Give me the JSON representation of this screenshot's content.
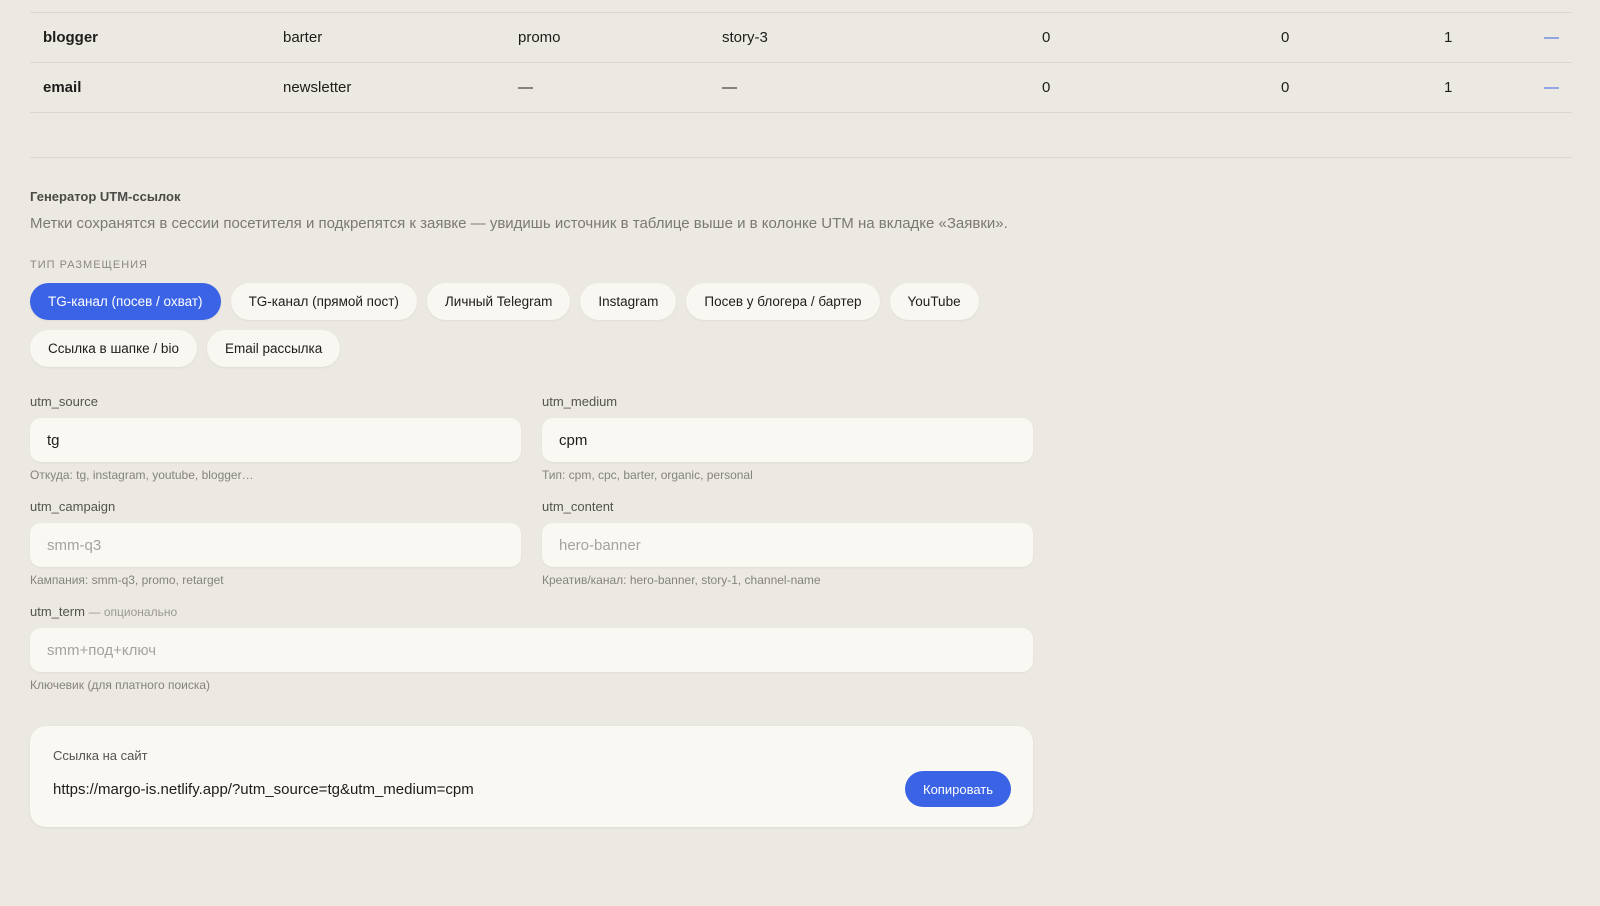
{
  "table": {
    "rows": [
      {
        "source": "blogger",
        "medium": "barter",
        "campaign": "promo",
        "content": "story-3",
        "n1": "0",
        "n2": "0",
        "n3": "1",
        "link": "—"
      },
      {
        "source": "email",
        "medium": "newsletter",
        "campaign": "—",
        "content": "—",
        "n1": "0",
        "n2": "0",
        "n3": "1",
        "link": "—"
      }
    ]
  },
  "generator": {
    "title": "Генератор UTM-ссылок",
    "description": "Метки сохранятся в сессии посетителя и подкрепятся к заявке — увидишь источник в таблице выше и в колонке UTM на вкладке «Заявки».",
    "type_label": "ТИП РАЗМЕЩЕНИЯ",
    "chips": [
      {
        "label": "TG-канал (посев / охват)",
        "active": true
      },
      {
        "label": "TG-канал (прямой пост)",
        "active": false
      },
      {
        "label": "Личный Telegram",
        "active": false
      },
      {
        "label": "Instagram",
        "active": false
      },
      {
        "label": "Посев у блогера / бартер",
        "active": false
      },
      {
        "label": "YouTube",
        "active": false
      },
      {
        "label": "Ссылка в шапке / bio",
        "active": false
      },
      {
        "label": "Email рассылка",
        "active": false
      }
    ],
    "fields": {
      "utm_source": {
        "label": "utm_source",
        "value": "tg",
        "hint": "Откуда: tg, instagram, youtube, blogger…"
      },
      "utm_medium": {
        "label": "utm_medium",
        "value": "cpm",
        "hint": "Тип: cpm, cpc, barter, organic, personal"
      },
      "utm_campaign": {
        "label": "utm_campaign",
        "placeholder": "smm-q3",
        "hint": "Кампания: smm-q3, promo, retarget"
      },
      "utm_content": {
        "label": "utm_content",
        "placeholder": "hero-banner",
        "hint": "Креатив/канал: hero-banner, story-1, channel-name"
      },
      "utm_term": {
        "label": "utm_term",
        "optional": "— опционально",
        "placeholder": "smm+под+ключ",
        "hint": "Ключевик (для платного поиска)"
      }
    },
    "result": {
      "title": "Ссылка на сайт",
      "url": "https://margo-is.netlify.app/?utm_source=tg&utm_medium=cpm",
      "copy_label": "Копировать"
    }
  },
  "colors": {
    "accent": "#3a63e6",
    "background": "#ece9e2",
    "surface": "#faf8f3"
  }
}
